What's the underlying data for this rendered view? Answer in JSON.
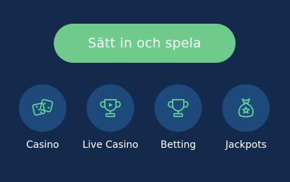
{
  "cta": {
    "label": "Sätt in och spela",
    "color": "#6fcb8b"
  },
  "categories": [
    {
      "label": "Casino",
      "icon": "dice-icon"
    },
    {
      "label": "Live Casino",
      "icon": "trophy-play-icon"
    },
    {
      "label": "Betting",
      "icon": "trophy-icon"
    },
    {
      "label": "Jackpots",
      "icon": "money-bag-star-icon"
    }
  ],
  "colors": {
    "background": "#132a4c",
    "circle": "#1e4a7b",
    "icon": "#5fd39a"
  }
}
